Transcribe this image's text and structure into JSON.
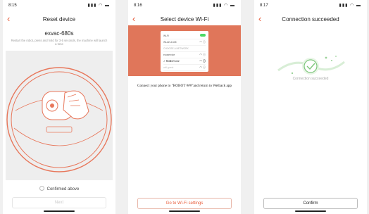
{
  "screens": [
    {
      "time": "8:15",
      "signal": "▮▮▮ ◠ ▬",
      "title": "Reset device",
      "model": "exvac-680s",
      "instruction": "Restart the robot, press and hold for 3-5 seconds, the machine will launch a tone",
      "confirm_label": "Confirmed above",
      "next_label": "Next"
    },
    {
      "time": "8:16",
      "signal": "▮▮▮ ◠ ▬",
      "title": "Select device Wi-Fi",
      "wifi_rows": [
        {
          "label": "Wi-Fi",
          "icon": ""
        },
        {
          "label": "WLAN-1345",
          "icon": "◠ ⓘ"
        },
        {
          "label": "CHOOSE A NETWORK",
          "icon": ""
        },
        {
          "label": "ecoservice",
          "icon": "◠ ⓘ"
        },
        {
          "label": "✓ ROBOT-###",
          "icon": "◠ ⓘ"
        },
        {
          "label": "wifi-guest",
          "icon": "◠ ⓘ"
        }
      ],
      "instruction": "Connect your phone to \"ROBOT ###\"and return to Welback app",
      "button_label": "Go to Wi-Fi settings"
    },
    {
      "time": "8:17",
      "signal": "▮▮▮ ◠ ▬",
      "title": "Connection succeeded",
      "status_text": "Connection succeeded",
      "button_label": "Confirm"
    }
  ],
  "colors": {
    "accent": "#e85c3a",
    "banner": "#e0765a",
    "success": "#7cc67a"
  }
}
